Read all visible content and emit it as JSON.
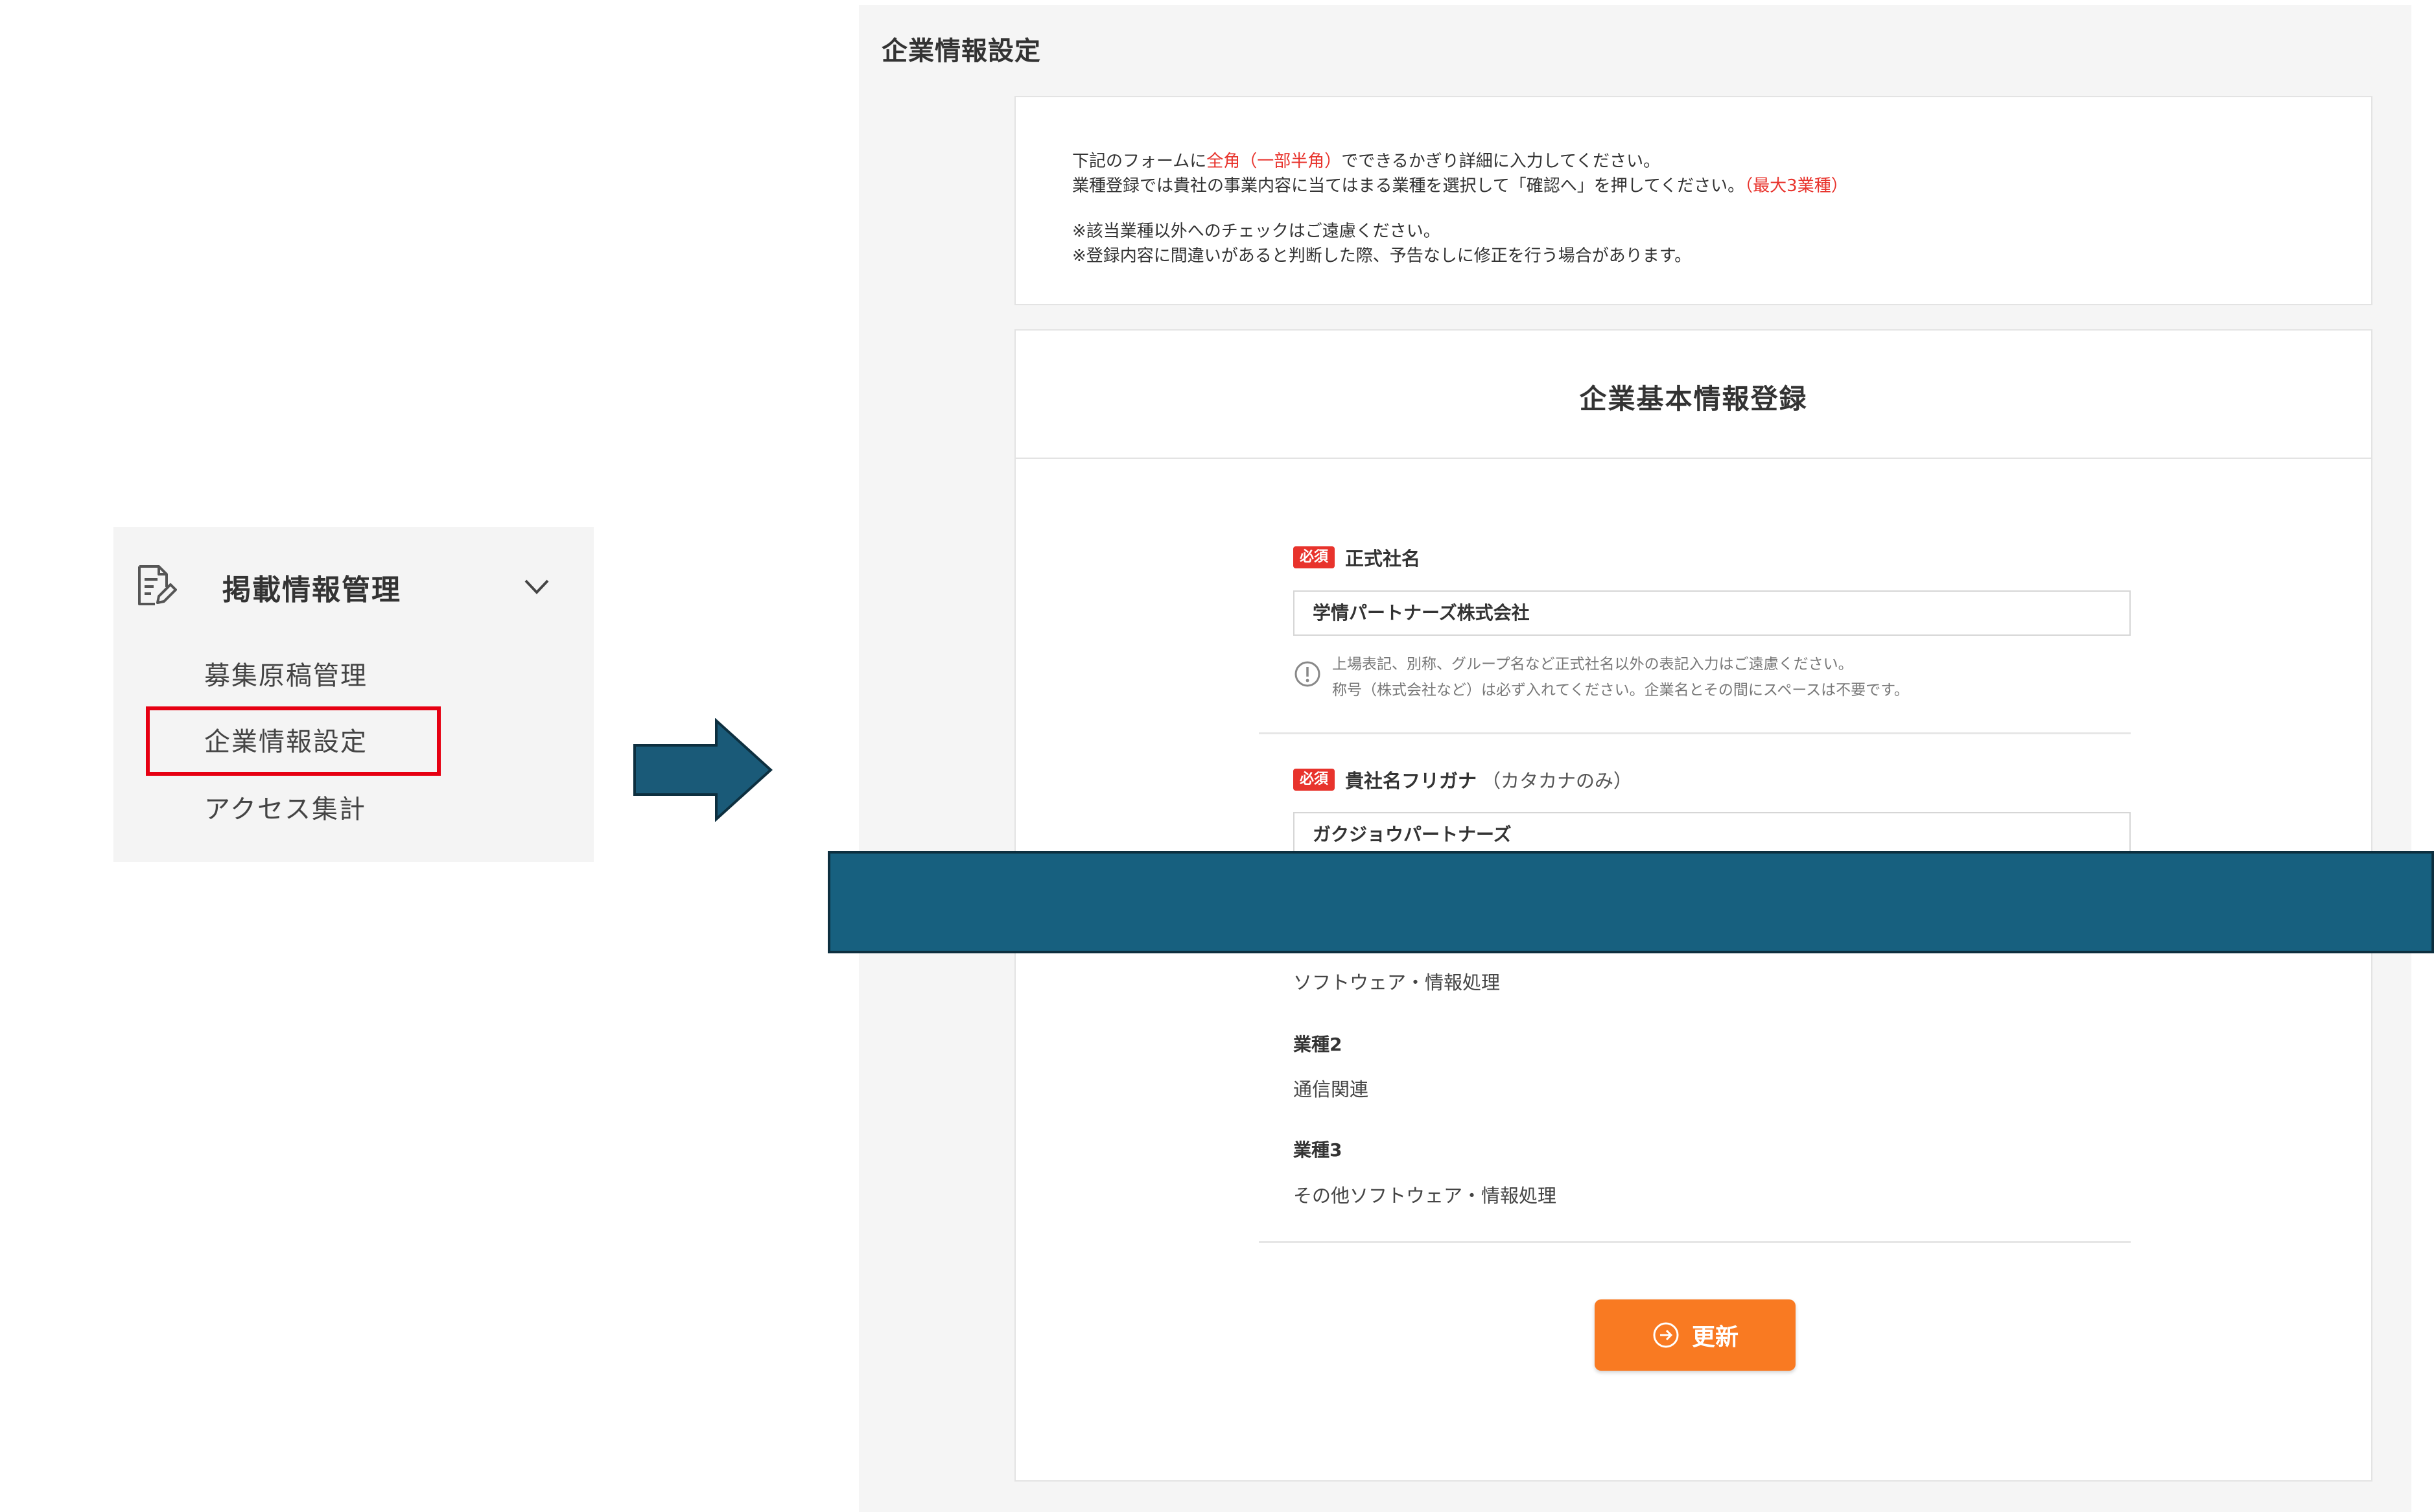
{
  "sidebar": {
    "title": "掲載情報管理",
    "items": [
      {
        "label": "募集原稿管理"
      },
      {
        "label": "企業情報設定",
        "highlighted": true
      },
      {
        "label": "アクセス集計"
      }
    ],
    "highlight_color": "#e60012"
  },
  "arrow": {
    "color": "#1a5a78"
  },
  "main": {
    "page_title": "企業情報設定",
    "notice": {
      "line1_a": "下記のフォームに",
      "line1_red": "全角（一部半角）",
      "line1_b": "でできるかぎり詳細に入力してください。",
      "line2_a": "業種登録では貴社の事業内容に当てはまる業種を選択して「確認へ」を押してください。",
      "line2_red": "（最大3業種）",
      "line3": "※該当業種以外へのチェックはご遠慮ください。",
      "line4": "※登録内容に間違いがあると判断した際、予告なしに修正を行う場合があります。"
    },
    "form": {
      "title": "企業基本情報登録",
      "required_badge": "必須",
      "field1": {
        "label": "正式社名",
        "value": "学情パートナーズ株式会社",
        "note1": "上場表記、別称、グループ名など正式社名以外の表記入力はご遠慮ください。",
        "note2": "称号（株式会社など）は必ず入れてください。企業名とその間にスペースは不要です。"
      },
      "field2": {
        "label": "貴社名フリガナ",
        "hint": "（カタカナのみ）",
        "value": "ガクジョウパートナーズ"
      },
      "industry1_value": "ソフトウェア・情報処理",
      "industry2_label": "業種2",
      "industry2_value": "通信関連",
      "industry3_label": "業種3",
      "industry3_value": "その他ソフトウェア・情報処理",
      "update_button": "更新",
      "accent_color": "#f97a22",
      "required_color": "#e8332c"
    }
  },
  "overlay": {
    "color": "#17607f"
  }
}
